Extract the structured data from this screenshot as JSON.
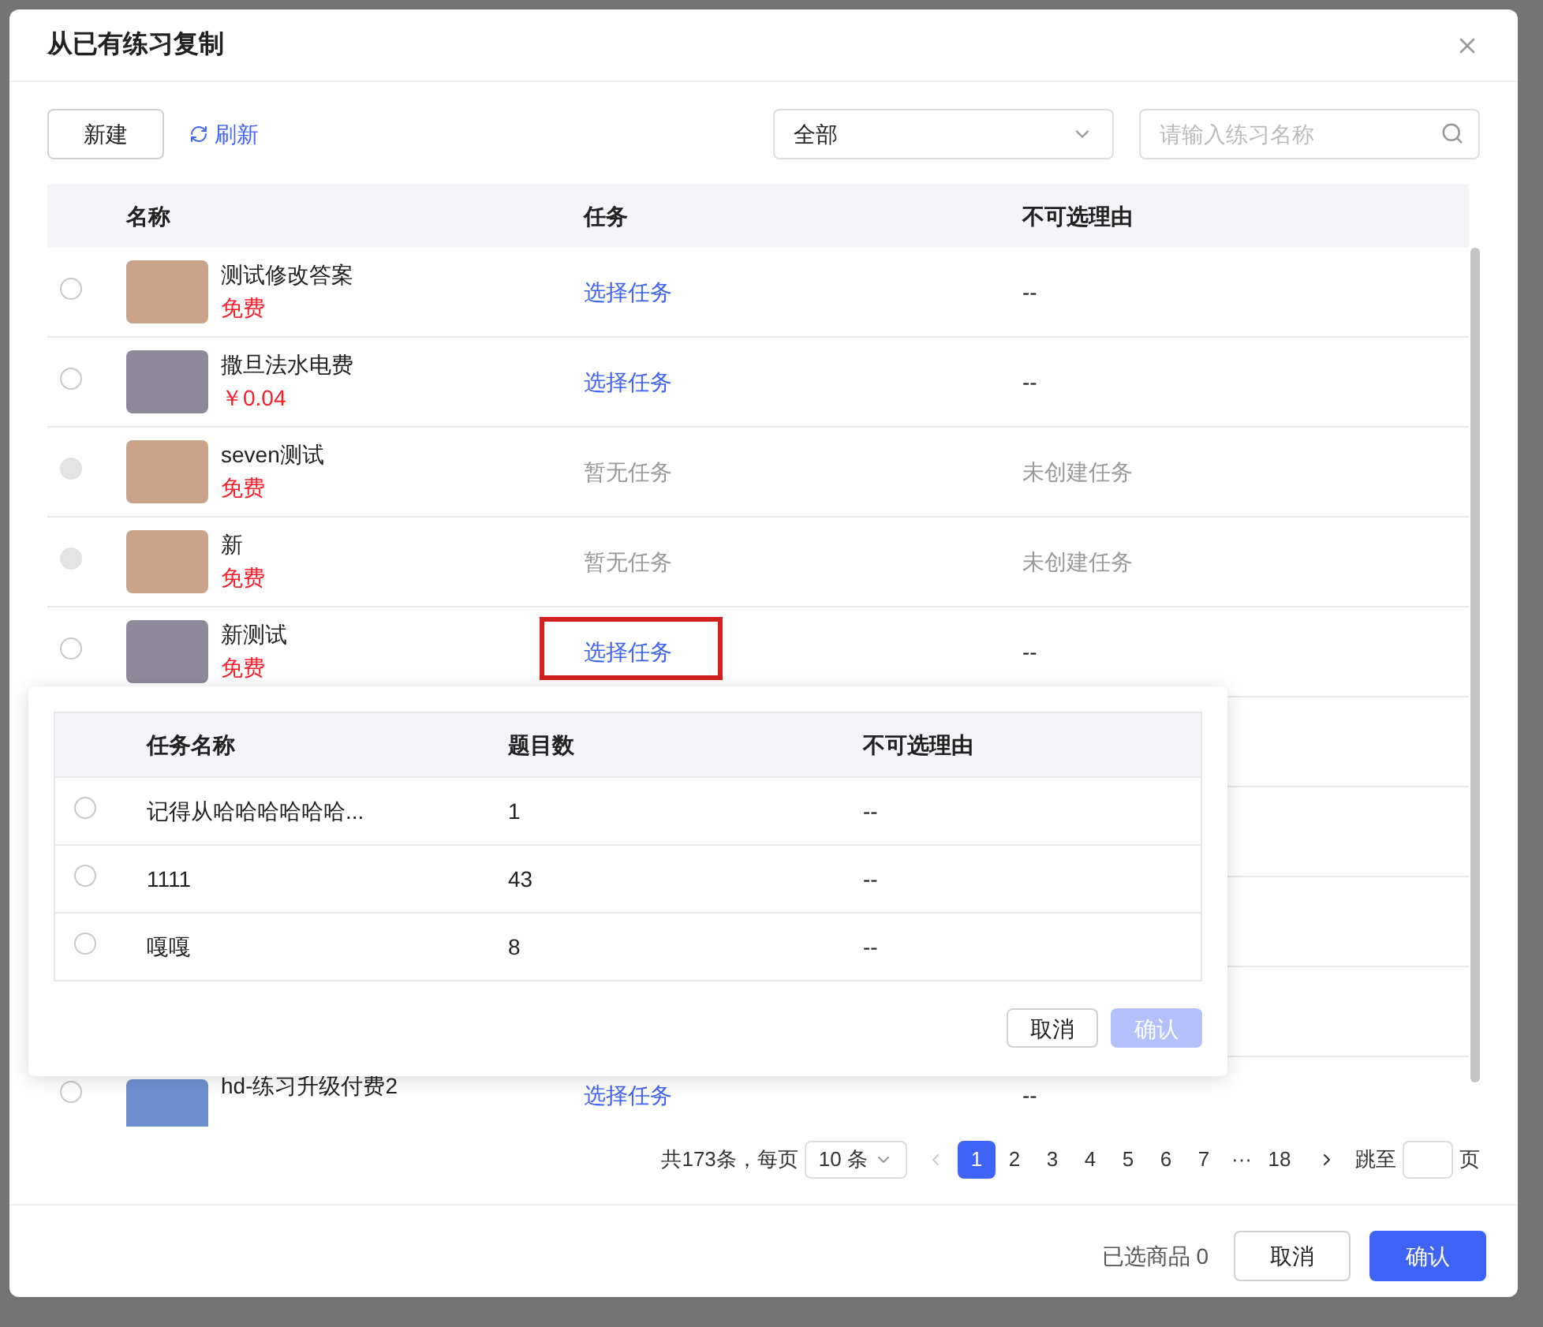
{
  "dialog": {
    "title": "从已有练习复制"
  },
  "toolbar": {
    "new_button": "新建",
    "refresh_link": "刷新",
    "filter_select": {
      "value": "全部"
    },
    "search": {
      "placeholder": "请输入练习名称"
    }
  },
  "table": {
    "columns": [
      "名称",
      "任务",
      "不可选理由"
    ],
    "rows": [
      {
        "name": "测试修改答案",
        "price": "免费",
        "kind": "warm",
        "selected": false,
        "disabled": false,
        "task": {
          "text": "选择任务",
          "kind": "link"
        },
        "reason": "--",
        "highlighted": false
      },
      {
        "name": "撒旦法水电费",
        "price": "￥0.04",
        "kind": "gray",
        "selected": false,
        "disabled": false,
        "task": {
          "text": "选择任务",
          "kind": "link"
        },
        "reason": "--",
        "highlighted": false
      },
      {
        "name": "seven测试",
        "price": "免费",
        "kind": "warm",
        "selected": false,
        "disabled": true,
        "task": {
          "text": "暂无任务",
          "kind": "none"
        },
        "reason": "未创建任务",
        "highlighted": false
      },
      {
        "name": "新",
        "price": "免费",
        "kind": "warm",
        "selected": false,
        "disabled": true,
        "task": {
          "text": "暂无任务",
          "kind": "none"
        },
        "reason": "未创建任务",
        "highlighted": false
      },
      {
        "name": "新测试",
        "price": "免费",
        "kind": "gray",
        "selected": false,
        "disabled": false,
        "task": {
          "text": "选择任务",
          "kind": "link"
        },
        "reason": "--",
        "highlighted": true
      }
    ],
    "last_row": {
      "name": "hd-练习升级付费2",
      "kind": "blue",
      "selected": false,
      "disabled": false,
      "task": {
        "text": "选择任务",
        "kind": "link"
      },
      "reason": "--"
    }
  },
  "task_popover": {
    "columns": [
      "任务名称",
      "题目数",
      "不可选理由"
    ],
    "rows": [
      {
        "name": "记得从哈哈哈哈哈哈...",
        "count": "1",
        "reason": "--",
        "selected": false
      },
      {
        "name": "1111",
        "count": "43",
        "reason": "--",
        "selected": false
      },
      {
        "name": "嘎嘎",
        "count": "8",
        "reason": "--",
        "selected": false
      }
    ],
    "cancel_button": "取消",
    "confirm_button": {
      "label": "确认",
      "disabled": true
    }
  },
  "pagination": {
    "total": "共173条，每页",
    "page_size": "10 条",
    "pages": [
      {
        "label": "1",
        "selected": true
      },
      {
        "label": "2",
        "selected": false
      },
      {
        "label": "3",
        "selected": false
      },
      {
        "label": "4",
        "selected": false
      },
      {
        "label": "5",
        "selected": false
      },
      {
        "label": "6",
        "selected": false
      },
      {
        "label": "7",
        "selected": false
      },
      {
        "label": "···",
        "selected": false
      },
      {
        "label": "18",
        "selected": false
      }
    ],
    "jump_label": "跳至",
    "page_unit": "页"
  },
  "footer": {
    "selected_count": "已选商品 0",
    "cancel_button": "取消",
    "confirm_button": "确认"
  }
}
